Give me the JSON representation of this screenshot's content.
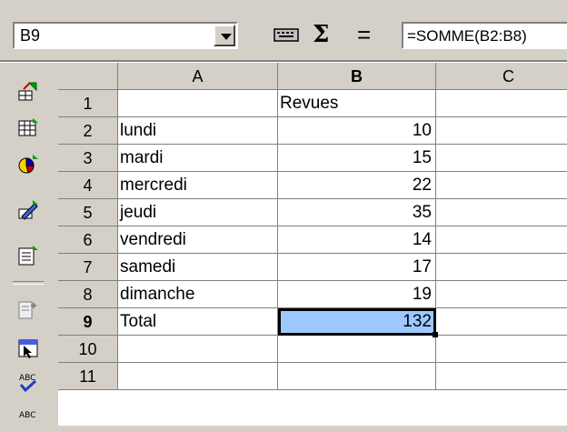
{
  "formula_bar": {
    "cell_ref": "B9",
    "formula": "=SOMME(B2:B8)",
    "icons": [
      "dropdown-arrow-icon",
      "function-autopilot-icon",
      "sum-icon",
      "equals-icon"
    ],
    "sum_symbol": "Σ",
    "equals_symbol": "="
  },
  "left_toolbar": {
    "icons": [
      "navigator-icon",
      "insert-table-icon",
      "insert-chart-icon",
      "insert-object-icon",
      "edit-object-icon",
      "insert-cells-icon",
      "select-icon",
      "spellcheck-icon",
      "auto-spellcheck-icon"
    ]
  },
  "sheet": {
    "columns": [
      "A",
      "B",
      "C"
    ],
    "active_column": "B",
    "active_row": "9",
    "rows": [
      {
        "row": "1",
        "a": "",
        "b": "Revues"
      },
      {
        "row": "2",
        "a": "lundi",
        "b": "10"
      },
      {
        "row": "3",
        "a": "mardi",
        "b": "15"
      },
      {
        "row": "4",
        "a": "mercredi",
        "b": "22"
      },
      {
        "row": "5",
        "a": "jeudi",
        "b": "35"
      },
      {
        "row": "6",
        "a": "vendredi",
        "b": "14"
      },
      {
        "row": "7",
        "a": "samedi",
        "b": "17"
      },
      {
        "row": "8",
        "a": "dimanche",
        "b": "19"
      },
      {
        "row": "9",
        "a": "Total",
        "b": "132"
      },
      {
        "row": "10",
        "a": "",
        "b": ""
      },
      {
        "row": "11",
        "a": "",
        "b": ""
      }
    ]
  },
  "colors": {
    "selection_fill": "#9ec8ff",
    "chrome": "#d4d0c8"
  }
}
